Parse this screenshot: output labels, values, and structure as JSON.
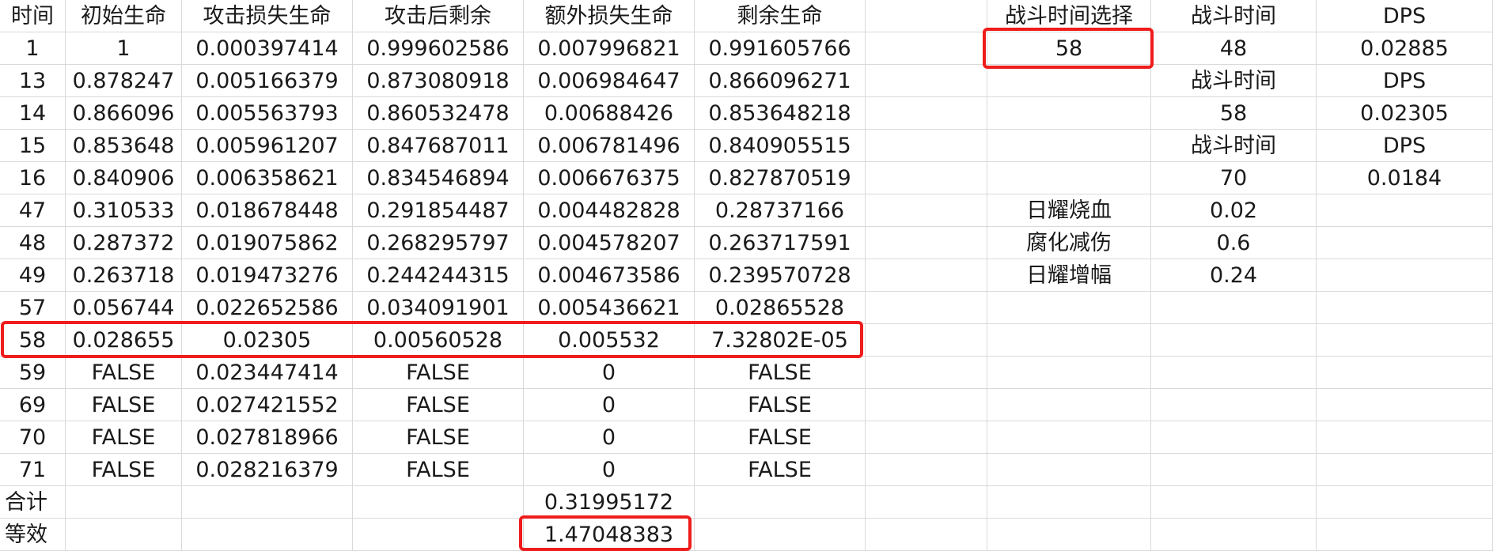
{
  "main_table": {
    "headers": [
      "时间",
      "初始生命",
      "攻击损失生命",
      "攻击后剩余",
      "额外损失生命",
      "剩余生命"
    ],
    "rows": [
      [
        "1",
        "1",
        "0.000397414",
        "0.999602586",
        "0.007996821",
        "0.991605766"
      ],
      [
        "13",
        "0.878247",
        "0.005166379",
        "0.873080918",
        "0.006984647",
        "0.866096271"
      ],
      [
        "14",
        "0.866096",
        "0.005563793",
        "0.860532478",
        "0.00688426",
        "0.853648218"
      ],
      [
        "15",
        "0.853648",
        "0.005961207",
        "0.847687011",
        "0.006781496",
        "0.840905515"
      ],
      [
        "16",
        "0.840906",
        "0.006358621",
        "0.834546894",
        "0.006676375",
        "0.827870519"
      ],
      [
        "47",
        "0.310533",
        "0.018678448",
        "0.291854487",
        "0.004482828",
        "0.28737166"
      ],
      [
        "48",
        "0.287372",
        "0.019075862",
        "0.268295797",
        "0.004578207",
        "0.263717591"
      ],
      [
        "49",
        "0.263718",
        "0.019473276",
        "0.244244315",
        "0.004673586",
        "0.239570728"
      ],
      [
        "57",
        "0.056744",
        "0.022652586",
        "0.034091901",
        "0.005436621",
        "0.02865528"
      ],
      [
        "58",
        "0.028655",
        "0.02305",
        "0.00560528",
        "0.005532",
        "7.32802E-05"
      ],
      [
        "59",
        "FALSE",
        "0.023447414",
        "FALSE",
        "0",
        "FALSE"
      ],
      [
        "69",
        "FALSE",
        "0.027421552",
        "FALSE",
        "0",
        "FALSE"
      ],
      [
        "70",
        "FALSE",
        "0.027818966",
        "FALSE",
        "0",
        "FALSE"
      ],
      [
        "71",
        "FALSE",
        "0.028216379",
        "FALSE",
        "0",
        "FALSE"
      ]
    ],
    "total_label": "合计",
    "total_value": "0.31995172",
    "equiv_label": "等效",
    "equiv_value": "1.47048383"
  },
  "side_panel": {
    "battle_time_select_label": "战斗时间选择",
    "battle_time_select_value": "58",
    "battle_time_label": "战斗时间",
    "dps_label": "DPS",
    "pairs": [
      {
        "time": "48",
        "dps": "0.02885"
      },
      {
        "time": "58",
        "dps": "0.02305"
      },
      {
        "time": "70",
        "dps": "0.0184"
      }
    ],
    "params": [
      {
        "name": "日耀烧血",
        "value": "0.02"
      },
      {
        "name": "腐化减伤",
        "value": "0.6"
      },
      {
        "name": "日耀增幅",
        "value": "0.24"
      }
    ]
  },
  "highlight_color": "#ef1c1c",
  "grid_color": "#d9d9d9"
}
